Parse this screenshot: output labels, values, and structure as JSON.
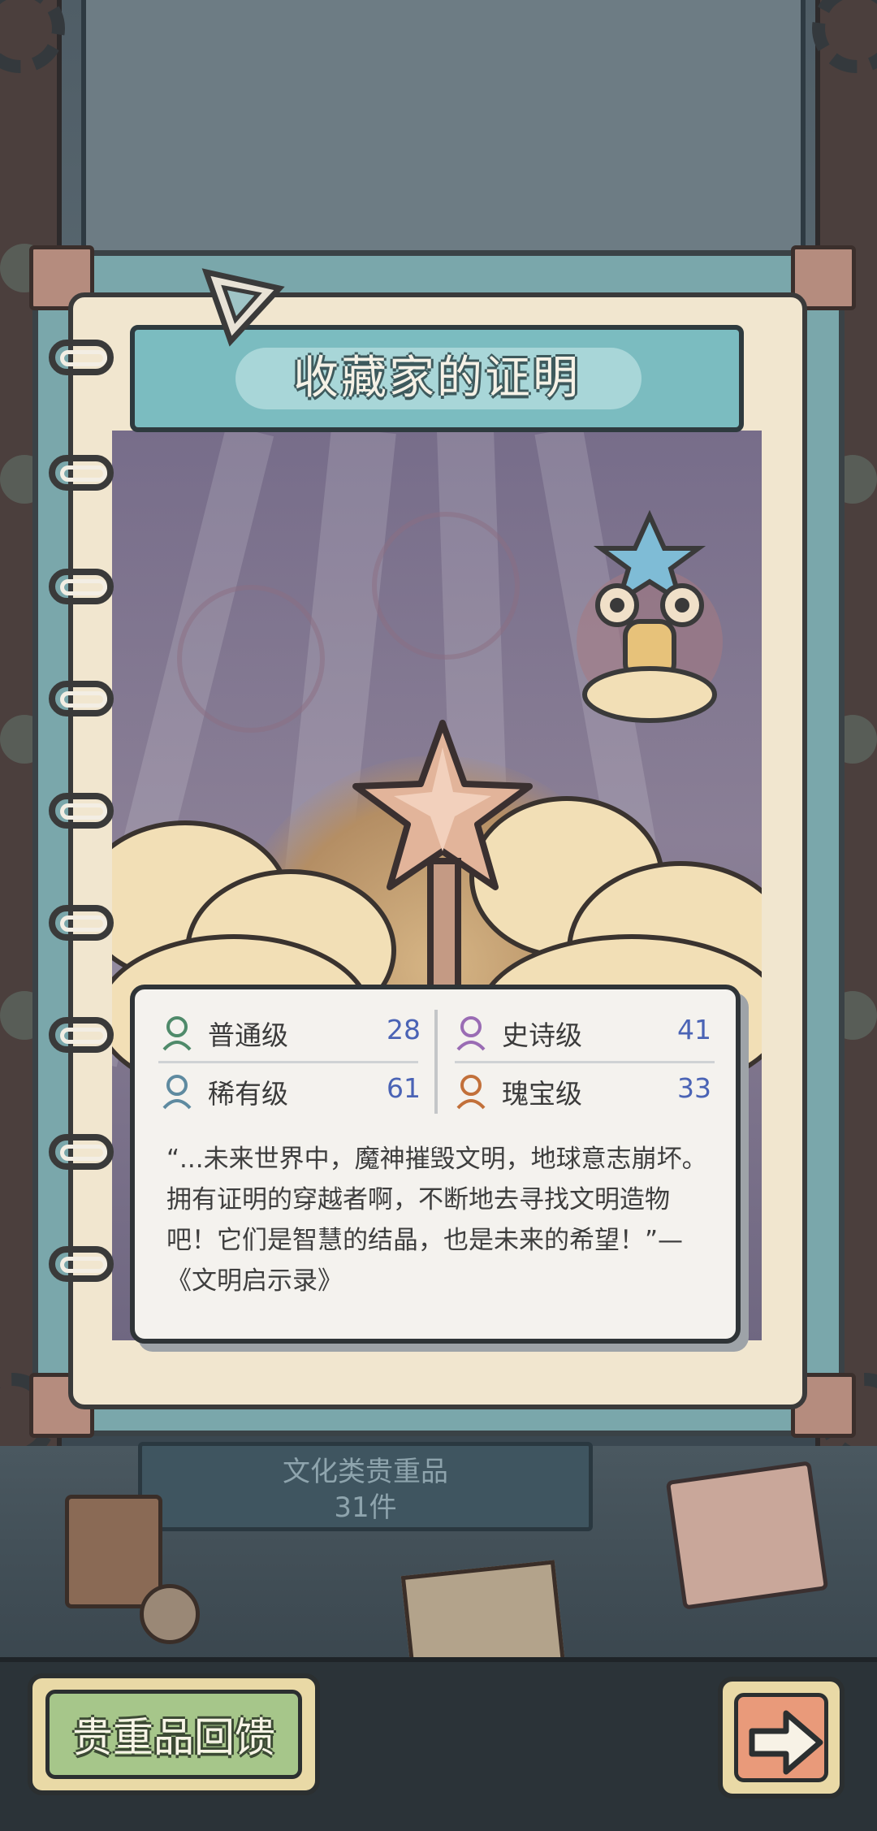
{
  "title": "收藏家的证明",
  "rarity_stats": [
    {
      "label": "普通级",
      "count": "28",
      "color": "#4f8a6a",
      "icon": "common-bust-icon"
    },
    {
      "label": "史诗级",
      "count": "41",
      "color": "#9a6cb4",
      "icon": "epic-bust-icon"
    },
    {
      "label": "稀有级",
      "count": "61",
      "color": "#5e8aa0",
      "icon": "rare-bust-icon"
    },
    {
      "label": "瑰宝级",
      "count": "33",
      "color": "#c2703a",
      "icon": "treasure-bust-icon"
    }
  ],
  "quote": "“...未来世界中，魔神摧毁文明，地球意志崩坏。拥有证明的穿越者啊，不断地去寻找文明造物吧！它们是智慧的结晶，也是未来的希望！”—《文明启示录》",
  "background_sign": {
    "line1": "文化类贵重品",
    "line2": "31件"
  },
  "buttons": {
    "feedback_label": "贵重品回馈",
    "next_icon": "right-arrow-icon"
  },
  "colors": {
    "banner": "#7bbcc0",
    "count_text": "#4a63b5",
    "feedback_button": "#a6c68a",
    "next_button": "#e99a7a"
  }
}
